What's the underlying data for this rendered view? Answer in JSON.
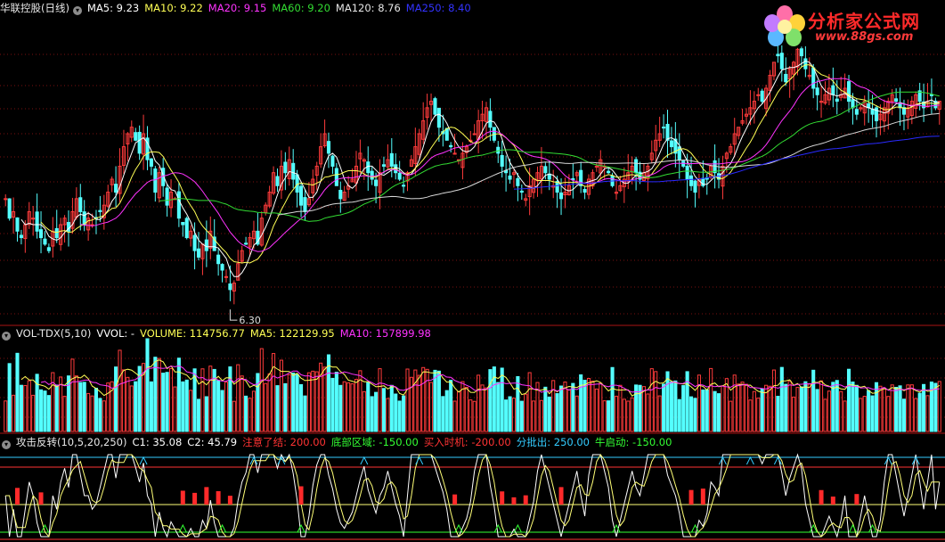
{
  "price_panel": {
    "title": "华联控股(日线)",
    "indicators": [
      {
        "label": "MA5: 9.23",
        "color": "#ffffff"
      },
      {
        "label": "MA10: 9.22",
        "color": "#ffff55"
      },
      {
        "label": "MA20: 9.15",
        "color": "#ff33ff"
      },
      {
        "label": "MA60: 9.20",
        "color": "#33dd33"
      },
      {
        "label": "MA120: 8.76",
        "color": "#e6e6e6"
      },
      {
        "label": "MA250: 8.40",
        "color": "#3333ff"
      }
    ],
    "low_marker": "6.30"
  },
  "volume_panel": {
    "title": "VOL-TDX(5,10)",
    "indicators": [
      {
        "label": "VVOL: -",
        "color": "#ffffff"
      },
      {
        "label": "VOLUME: 114756.77",
        "color": "#ffff55"
      },
      {
        "label": "MA5: 122129.95",
        "color": "#ffff55"
      },
      {
        "label": "MA10: 157899.98",
        "color": "#ff33ff"
      }
    ]
  },
  "indicator_panel": {
    "title": "攻击反转(10,5,20,250)",
    "indicators": [
      {
        "label": "C1: 35.08",
        "color": "#ffffff"
      },
      {
        "label": "C2: 45.79",
        "color": "#ffffff"
      },
      {
        "label": "注意了结: 200.00",
        "color": "#ff3333"
      },
      {
        "label": "底部区域: -150.00",
        "color": "#33ff33"
      },
      {
        "label": "买入时机: -200.00",
        "color": "#ff3333"
      },
      {
        "label": "分批出: 250.00",
        "color": "#33ccff"
      },
      {
        "label": "牛启动: -150.00",
        "color": "#33ff33"
      }
    ]
  },
  "logo": {
    "name": "分析家公式网",
    "url": "www.88gs.com"
  },
  "chart_data": [
    {
      "type": "candlestick",
      "title": "华联控股(日线)",
      "ylim_approx": [
        6.0,
        10.0
      ],
      "series_names": [
        "MA5",
        "MA10",
        "MA20",
        "MA60",
        "MA120",
        "MA250"
      ],
      "last_values": {
        "MA5": 9.23,
        "MA10": 9.22,
        "MA20": 9.15,
        "MA60": 9.2,
        "MA120": 8.76,
        "MA250": 8.4
      },
      "annotated_low": 6.3,
      "closes": [
        7.8,
        7.5,
        7.6,
        7.3,
        7.2,
        7.4,
        7.6,
        7.5,
        7.3,
        7.2,
        7.1,
        7.0,
        7.3,
        7.2,
        7.4,
        7.5,
        7.3,
        7.6,
        7.8,
        7.6,
        7.4,
        7.5,
        7.4,
        7.5,
        7.6,
        7.7,
        7.9,
        8.1,
        7.9,
        8.3,
        8.6,
        8.8,
        8.9,
        8.7,
        8.5,
        8.8,
        8.4,
        8.3,
        7.9,
        8.2,
        8.0,
        7.7,
        7.9,
        7.8,
        7.5,
        7.4,
        7.2,
        7.3,
        7.0,
        6.9,
        7.1,
        7.0,
        7.3,
        7.0,
        6.8,
        6.7,
        6.6,
        6.4,
        6.5,
        6.8,
        7.0,
        7.1,
        7.2,
        7.3,
        7.1,
        7.5,
        7.7,
        7.9,
        8.2,
        8.0,
        8.3,
        8.2,
        8.4,
        8.1,
        7.9,
        7.7,
        7.6,
        7.8,
        8.1,
        8.3,
        8.6,
        8.8,
        8.5,
        8.3,
        8.0,
        7.8,
        7.9,
        8.0,
        8.1,
        8.3,
        8.5,
        8.4,
        8.2,
        8.1,
        8.0,
        8.2,
        8.3,
        8.4,
        8.3,
        8.2,
        8.1,
        8.0,
        8.2,
        8.4,
        8.6,
        8.8,
        9.0,
        9.2,
        9.3,
        9.1,
        8.9,
        8.8,
        8.7,
        8.6,
        8.5,
        8.4,
        8.5,
        8.6,
        8.7,
        8.8,
        9.0,
        9.1,
        9.2,
        8.9,
        8.7,
        8.5,
        8.3,
        8.2,
        8.1,
        8.2,
        8.0,
        7.9,
        7.8,
        8.0,
        8.1,
        8.2,
        8.3,
        8.2,
        8.1,
        8.0,
        7.9,
        7.8,
        7.9,
        8.0,
        8.1,
        8.2,
        8.0,
        7.9,
        8.1,
        8.2,
        8.3,
        8.4,
        8.3,
        8.2,
        8.0,
        7.9,
        8.0,
        8.1,
        8.2,
        8.3,
        8.2,
        8.1,
        8.2,
        8.3,
        8.5,
        8.7,
        8.8,
        8.9,
        8.7,
        8.6,
        8.5,
        8.4,
        8.3,
        8.1,
        8.0,
        7.9,
        8.1,
        8.0,
        8.1,
        8.3,
        8.2,
        8.1,
        8.3,
        8.5,
        8.6,
        8.8,
        8.9,
        9.0,
        9.1,
        9.2,
        9.3,
        9.4,
        9.3,
        9.5,
        9.7,
        9.9,
        10.0,
        9.8,
        9.6,
        9.8,
        9.9,
        10.1,
        10.0,
        9.8,
        9.7,
        9.5,
        9.4,
        9.3,
        9.4,
        9.5,
        9.4,
        9.3,
        9.4,
        9.5,
        9.3,
        9.2,
        9.1,
        9.2,
        9.3,
        9.2,
        9.1,
        9.0,
        9.1,
        9.2,
        9.3,
        9.4,
        9.3,
        9.2,
        9.1,
        9.2,
        9.3,
        9.4,
        9.3,
        9.2,
        9.3,
        9.4,
        9.2,
        9.3
      ]
    },
    {
      "type": "bar",
      "title": "VOL-TDX(5,10)",
      "last_values": {
        "VOLUME": 114756.77,
        "MA5": 122129.95,
        "MA10": 157899.98
      }
    },
    {
      "type": "line",
      "title": "攻击反转(10,5,20,250)",
      "last_values": {
        "C1": 35.08,
        "C2": 45.79,
        "注意了结": 200.0,
        "底部区域": -150.0,
        "买入时机": -200.0,
        "分批出": 250.0,
        "牛启动": -150.0
      }
    }
  ]
}
